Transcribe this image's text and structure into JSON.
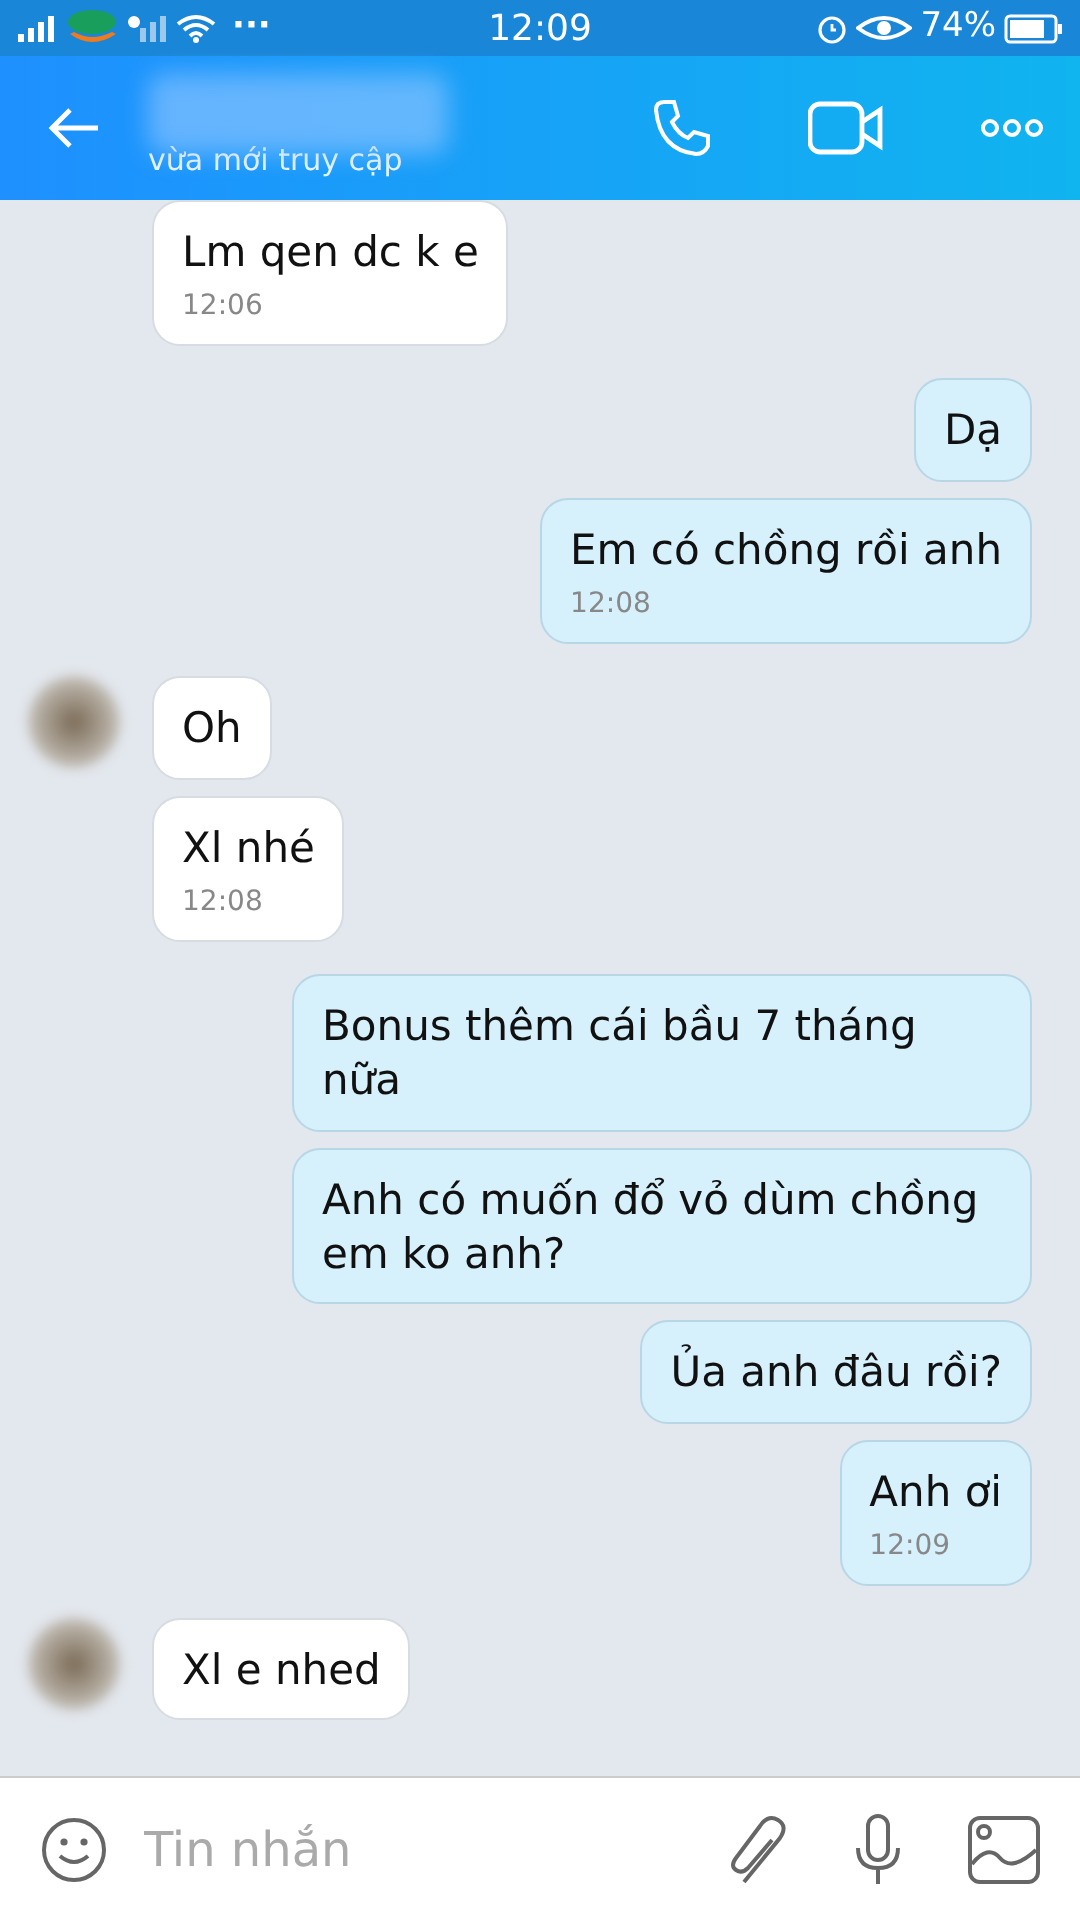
{
  "status_bar": {
    "dots": "···",
    "time": "12:09",
    "battery": "74%"
  },
  "header": {
    "subtitle": "vừa mới truy cập"
  },
  "messages": [
    {
      "kind": "received",
      "avatar": false,
      "text": "Lm qen dc k e",
      "time": "12:06"
    },
    {
      "kind": "sent",
      "text": "Dạ"
    },
    {
      "kind": "sent",
      "text": "Em có chồng rồi anh",
      "time": "12:08"
    },
    {
      "kind": "received",
      "avatar": true,
      "text": "Oh"
    },
    {
      "kind": "received",
      "avatar": false,
      "text": "Xl nhé",
      "time": "12:08"
    },
    {
      "kind": "sent",
      "text": "Bonus thêm cái bầu 7 tháng nữa"
    },
    {
      "kind": "sent",
      "text": "Anh có muốn đổ vỏ dùm chồng em ko anh?"
    },
    {
      "kind": "sent",
      "text": "Ủa anh đâu rồi?"
    },
    {
      "kind": "sent",
      "text": "Anh ơi",
      "time": "12:09"
    },
    {
      "kind": "received",
      "avatar": true,
      "text": "Xl e nhed"
    }
  ],
  "composer": {
    "placeholder": "Tin nhắn"
  }
}
